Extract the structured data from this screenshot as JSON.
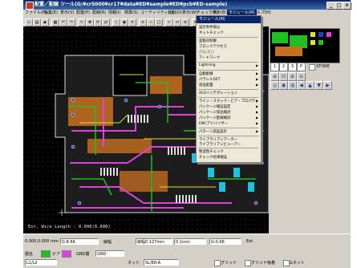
{
  "title": "配置／配線 ツール(G:¥cr5000¥cr17¥data¥ED¥sample¥ED¥pcb¥ED-sample)",
  "menu": [
    {
      "label": "ファイル(F)"
    },
    {
      "label": "編集(E)"
    },
    {
      "label": "表示(V)"
    },
    {
      "label": "配置(P)"
    },
    {
      "label": "配線(R)"
    },
    {
      "label": "情報(I)"
    },
    {
      "label": "標準(S)"
    },
    {
      "label": "ユーティリティ(U)"
    },
    {
      "label": "分割(D)"
    },
    {
      "label": "表示(W)"
    },
    {
      "label": "チェック(K)"
    },
    {
      "label": "表示(B)"
    },
    {
      "label": "モジュール(M)"
    },
    {
      "label": "ヘルプ(H)"
    }
  ],
  "popup": {
    "header": "モジュール(M)",
    "groups": [
      [
        "設計条件取込",
        "ネットチェック"
      ],
      [
        "差動対制御",
        "ブロックアクセス",
        "反転/反対",
        "アートワーク"
      ],
      [
        "Lightning"
      ],
      [
        "自動配線",
        "パラレルGET",
        "部品配置"
      ],
      [
        "ACSインテグレーション"
      ],
      [
        "ライン・スタック・ビア・プロパティ",
        "パッケージ検証設定",
        "パッケージ部品検討",
        "パッケージ配線検討",
        "EMCアドバイザー"
      ],
      [
        "パターン部品設計"
      ],
      [
        "ライブラリアンアーター",
        "ライブラリアンビューアー"
      ],
      [
        "製造性チェック",
        "チェック結果検証"
      ]
    ]
  },
  "status_wire": "Ext. Wire Length : 0.000(0.000)",
  "rpanel": {
    "layers": [
      "1",
      "2",
      "3",
      "P"
    ],
    "store": "STORE",
    "minimap_labels": [
      "L",
      "1",
      "2",
      "3",
      "4"
    ]
  },
  "bottom": {
    "coord": "0.000,0.000",
    "unit_label": "mm",
    "layer_label": "層名",
    "layer_value": "L1/L2",
    "via_label": "ビア",
    "width_label": "線幅",
    "width_value": "線幅0.127mm",
    "net_label": "ネット",
    "net_value": "G-8.66",
    "grid_label": "グリッド",
    "grid_value": "0.1mm",
    "space_label": "GND層",
    "space_value": "GND",
    "pin_label": "パッド",
    "pin_value": "G-0.66",
    "snap_label": "グリッド",
    "snap2_label": "グリッド吸着",
    "net_lbl2": "Gネット",
    "layer_dd": "SL/ER-A",
    "layer_dd2": "Ext"
  },
  "colors": {
    "board": "#2e2e2e",
    "copper": "#c87020",
    "magenta": "#e040e0",
    "green": "#20c020",
    "yellow": "#e0e040",
    "cyan": "#20c0e0",
    "blue": "#2040c0"
  }
}
